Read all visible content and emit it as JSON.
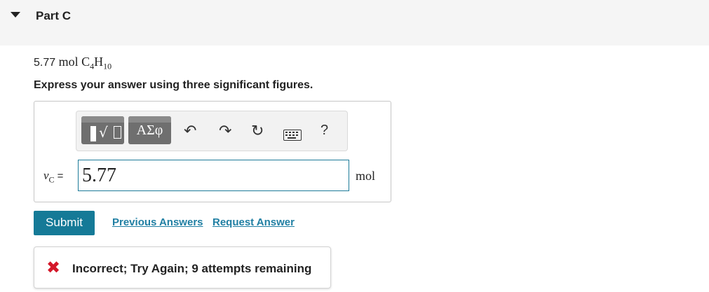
{
  "part": {
    "title": "Part C"
  },
  "question": {
    "given_value": "5.77",
    "given_unit": "mol",
    "formula": {
      "c": "C",
      "c_sub": "4",
      "h": "H",
      "h_sub": "10"
    },
    "instruction": "Express your answer using three significant figures."
  },
  "toolbar": {
    "buttons": [
      {
        "name": "templates-button",
        "icon": "matrix-sqrt-template-icon"
      },
      {
        "name": "greek-symbols-button",
        "label": "ΑΣφ"
      },
      {
        "name": "undo-button",
        "icon": "undo-icon"
      },
      {
        "name": "redo-button",
        "icon": "redo-icon"
      },
      {
        "name": "reset-button",
        "icon": "reset-icon"
      },
      {
        "name": "keyboard-button",
        "icon": "keyboard-icon"
      },
      {
        "name": "help-button",
        "label": "?"
      }
    ]
  },
  "answer": {
    "variable": "ν",
    "variable_sub": "C",
    "equals": "=",
    "value": "5.77",
    "units": "mol"
  },
  "actions": {
    "submit": "Submit",
    "previous_answers": "Previous Answers",
    "request_answer": "Request Answer"
  },
  "feedback": {
    "status": "incorrect",
    "icon": "close-x-icon",
    "color": "#d4182a",
    "message": "Incorrect; Try Again; 9 attempts remaining"
  },
  "colors": {
    "accent": "#157a97",
    "link": "#207fa3",
    "input_border": "#1d7b99"
  }
}
